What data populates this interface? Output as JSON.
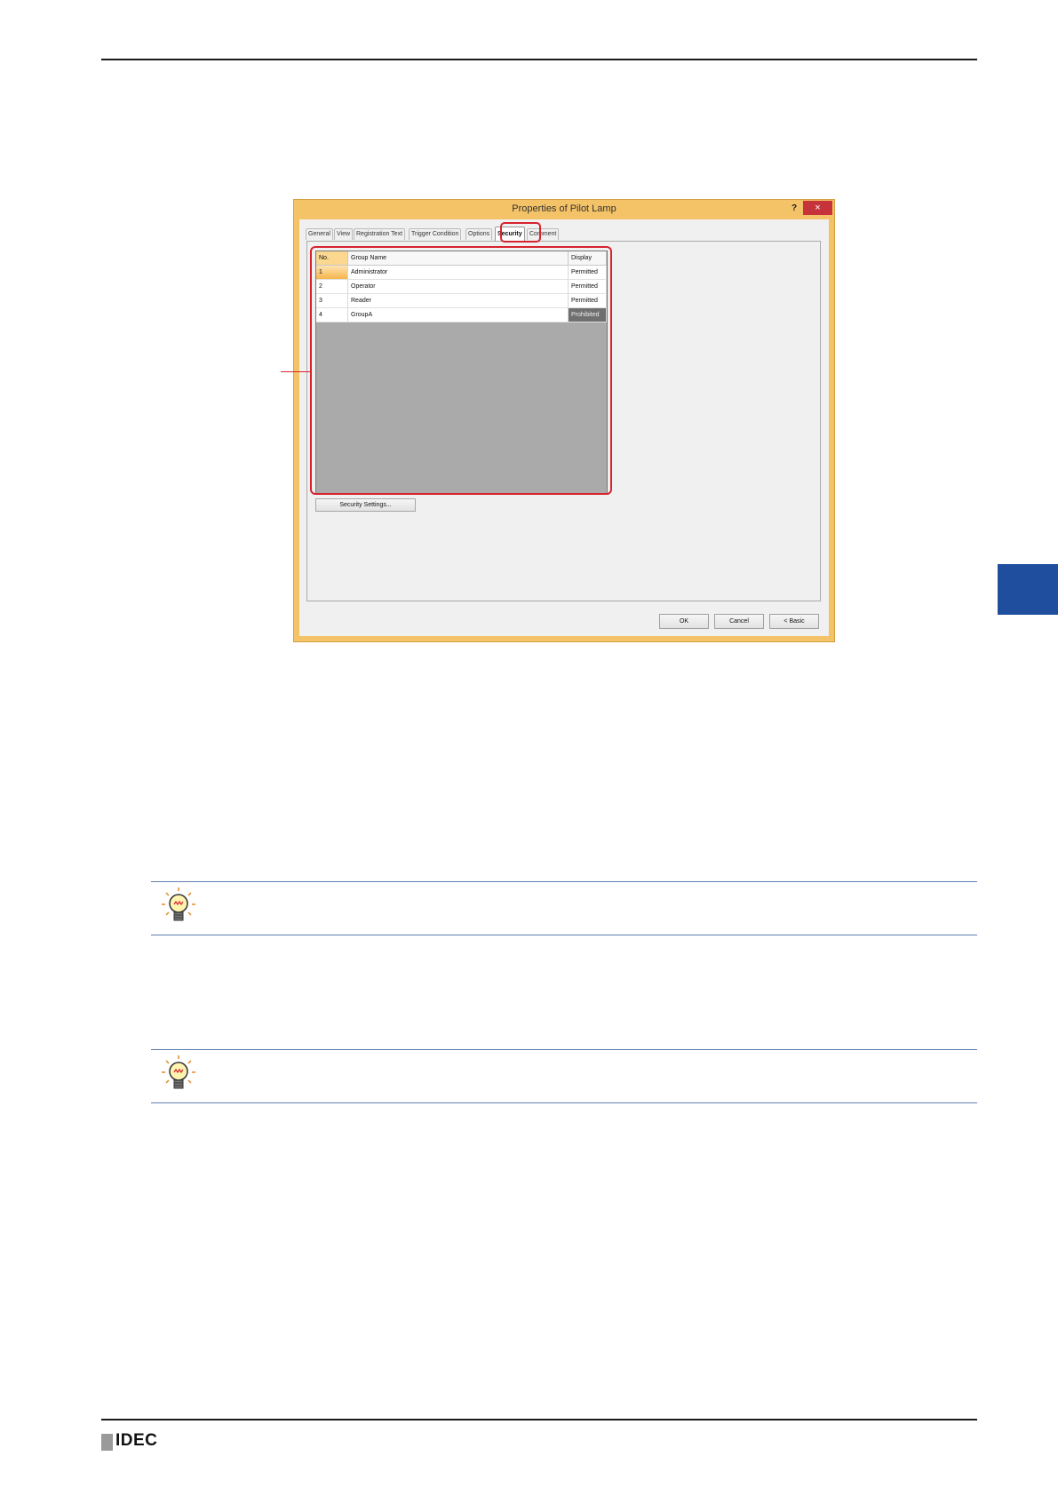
{
  "dialog": {
    "title": "Properties of Pilot Lamp",
    "help": "?",
    "close": "×",
    "tabs": [
      "General",
      "View",
      "Registration Text",
      "Trigger Condition",
      "Options",
      "Security",
      "Comment"
    ],
    "active_tab": "Security"
  },
  "grid": {
    "headers": {
      "no": "No.",
      "name": "Group Name",
      "display": "Display"
    },
    "rows": [
      {
        "no": "1",
        "name": "Administrator",
        "display": "Permitted"
      },
      {
        "no": "2",
        "name": "Operator",
        "display": "Permitted"
      },
      {
        "no": "3",
        "name": "Reader",
        "display": "Permitted"
      },
      {
        "no": "4",
        "name": "GroupA",
        "display": "Prohibited"
      }
    ]
  },
  "buttons": {
    "security_settings": "Security Settings...",
    "ok": "OK",
    "cancel": "Cancel",
    "basic": "< Basic"
  },
  "colors": {
    "accent_highlight": "#d6232e",
    "window_frame": "#f4c267",
    "side_tab": "#1f4e9e"
  },
  "footer": {
    "logo": "IDEC"
  },
  "icons": {
    "hint": "lightbulb-icon"
  }
}
